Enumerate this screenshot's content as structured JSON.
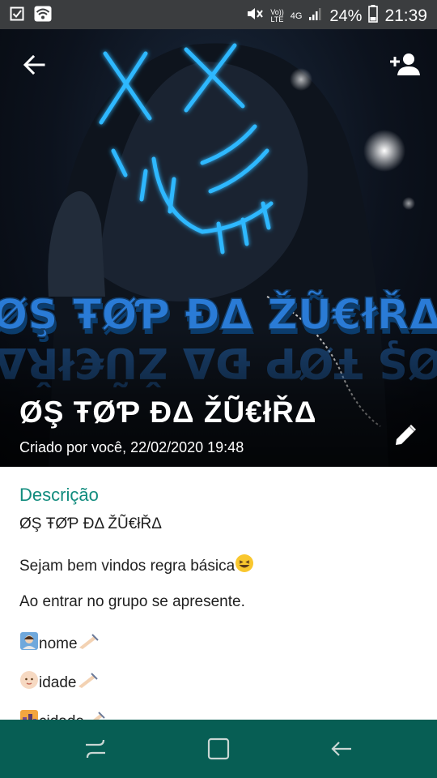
{
  "status_bar": {
    "battery_percent": "24%",
    "time": "21:39",
    "network": "4G",
    "volte": [
      "Vo))",
      "LTE"
    ]
  },
  "header": {
    "banner_text": "ØŞ ŦØƤ ĐΔ ŽŨ€łŘΔ",
    "title": "ØŞ ŦØƤ ĐΔ ŽŨ€łŘΔ",
    "subtitle": "Criado por você, 22/02/2020 19:48",
    "icons": [
      "arrow-back-icon",
      "person-add-icon",
      "pencil-icon"
    ]
  },
  "description": {
    "heading": "Descrição",
    "lines": [
      "ØŞ ŦØƤ ĐΔ ŽŨ€łŘΔ",
      "Sejam bem vindos regra básica",
      "Ao entrar no grupo se apresente.",
      "nome",
      "idade",
      "cidade"
    ]
  },
  "colors": {
    "accent": "#128c7e",
    "nav_bar": "#075e54",
    "status_bar": "#3b3d3f"
  }
}
